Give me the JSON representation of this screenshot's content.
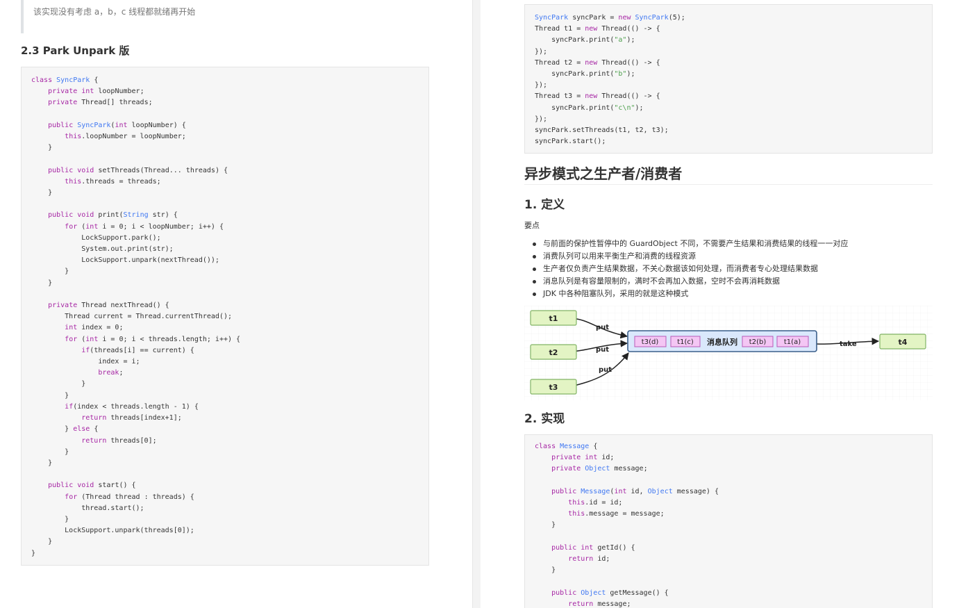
{
  "left": {
    "note": "该实现没有考虑 a，b，c 线程都就绪再开始",
    "heading": "2.3 Park Unpark 版"
  },
  "right": {
    "section_title": "异步模式之生产者/消费者",
    "def_heading": "1. 定义",
    "key_points_label": "要点",
    "bullets": [
      "与前面的保护性暂停中的 GuardObject 不同，不需要产生结果和消费结果的线程一一对应",
      "消费队列可以用来平衡生产和消费的线程资源",
      "生产者仅负责产生结果数据，不关心数据该如何处理，而消费者专心处理结果数据",
      "消息队列是有容量限制的，满时不会再加入数据，空时不会再消耗数据",
      "JDK 中各种阻塞队列，采用的就是这种模式"
    ],
    "impl_heading": "2. 实现",
    "diagram": {
      "producers": [
        "t1",
        "t2",
        "t3"
      ],
      "put_label": "put",
      "take_label": "take",
      "queue_label": "消息队列",
      "queue_items_left": [
        "t3(d)",
        "t1(c)"
      ],
      "queue_items_right": [
        "t2(b)",
        "t1(a)"
      ],
      "consumer": "t4",
      "colors": {
        "node_fill": "#e3f4c4",
        "node_stroke": "#82b366",
        "queue_fill": "#dae8fc",
        "queue_stroke": "#3a5f8a",
        "item_fill": "#f4c6f4",
        "item_stroke": "#b85ab8"
      }
    }
  },
  "code_left_lines": [
    "class SyncPark {",
    "    private int loopNumber;",
    "    private Thread[] threads;",
    "",
    "    public SyncPark(int loopNumber) {",
    "        this.loopNumber = loopNumber;",
    "    }",
    "",
    "    public void setThreads(Thread... threads) {",
    "        this.threads = threads;",
    "    }",
    "",
    "    public void print(String str) {",
    "        for (int i = 0; i < loopNumber; i++) {",
    "            LockSupport.park();",
    "            System.out.print(str);",
    "            LockSupport.unpark(nextThread());",
    "        }",
    "    }",
    "",
    "    private Thread nextThread() {",
    "        Thread current = Thread.currentThread();",
    "        int index = 0;",
    "        for (int i = 0; i < threads.length; i++) {",
    "            if(threads[i] == current) {",
    "                index = i;",
    "                break;",
    "            }",
    "        }",
    "        if(index < threads.length - 1) {",
    "            return threads[index+1];",
    "        } else {",
    "            return threads[0];",
    "        }",
    "    }",
    "",
    "    public void start() {",
    "        for (Thread thread : threads) {",
    "            thread.start();",
    "        }",
    "        LockSupport.unpark(threads[0]);",
    "    }",
    "}"
  ],
  "code_right_top_lines": [
    "SyncPark syncPark = new SyncPark(5);",
    "Thread t1 = new Thread(() -> {",
    "    syncPark.print(\"a\");",
    "});",
    "Thread t2 = new Thread(() -> {",
    "    syncPark.print(\"b\");",
    "});",
    "Thread t3 = new Thread(() -> {",
    "    syncPark.print(\"c\\n\");",
    "});",
    "syncPark.setThreads(t1, t2, t3);",
    "syncPark.start();"
  ],
  "code_right_bottom_lines": [
    "class Message {",
    "    private int id;",
    "    private Object message;",
    "",
    "    public Message(int id, Object message) {",
    "        this.id = id;",
    "        this.message = message;",
    "    }",
    "",
    "    public int getId() {",
    "        return id;",
    "    }",
    "",
    "    public Object getMessage() {",
    "        return message;"
  ]
}
